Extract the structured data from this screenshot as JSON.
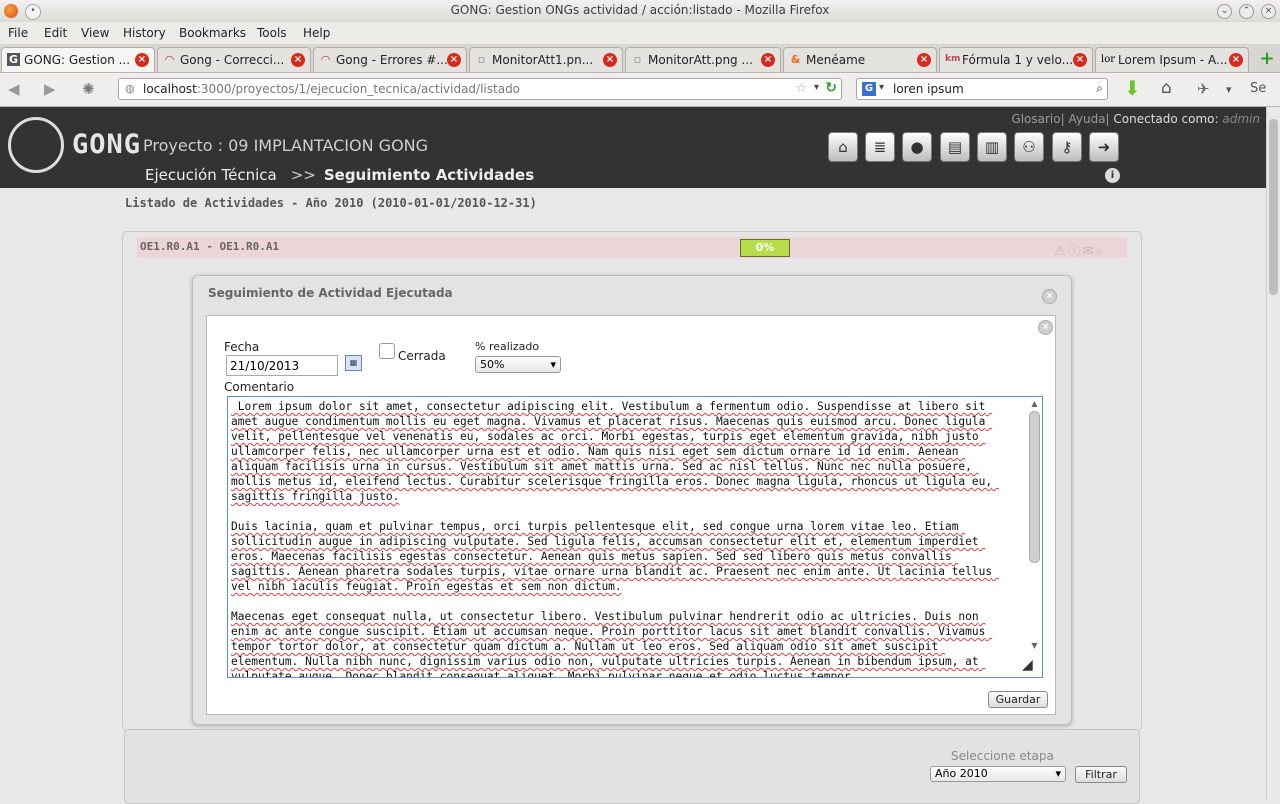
{
  "window": {
    "title": "GONG: Gestion ONGs actividad / acción:listado - Mozilla Firefox"
  },
  "menu": [
    "File",
    "Edit",
    "View",
    "History",
    "Bookmarks",
    "Tools",
    "Help"
  ],
  "tabs": [
    {
      "label": "GONG: Gestion ...",
      "icon": "G"
    },
    {
      "label": "Gong - Correcci...",
      "icon": "◠"
    },
    {
      "label": "Gong - Errores #...",
      "icon": "◠"
    },
    {
      "label": "MonitorAtt1.pn...",
      "icon": "▫"
    },
    {
      "label": "MonitorAtt.png ...",
      "icon": "▫"
    },
    {
      "label": "Menéame",
      "icon": "&"
    },
    {
      "label": "Fórmula 1 y velo...",
      "icon": "km"
    },
    {
      "label": "Lorem Ipsum - A...",
      "icon": "lor"
    }
  ],
  "nav": {
    "url_host": "localhost",
    "url_path": ":3000/proyectos/1/ejecucion_tecnica/actividad/listado",
    "search_query": "loren ipsum"
  },
  "app": {
    "logo": "GONG",
    "project": "Proyecto : 09 IMPLANTACION GONG",
    "links": {
      "glosario": "Glosario",
      "ayuda": "Ayuda",
      "conectado": "Conectado como:",
      "user": "admin"
    },
    "breadcrumb": {
      "section": "Ejecución Técnica",
      "separator": ">>",
      "current": "Seguimiento Actividades"
    },
    "header_icons": [
      "home-icon",
      "database-icon",
      "user-icon",
      "book-icon",
      "chart-icon",
      "users-icon",
      "key-icon",
      "logout-icon"
    ]
  },
  "list": {
    "title": "Listado de Actividades - Año 2010 (2010-01-01/2010-12-31)",
    "activity_code": "OE1.R0.A1 - OE1.R0.A1",
    "progress": "0%"
  },
  "modal": {
    "title": "Seguimiento de Actividad Ejecutada",
    "fecha_label": "Fecha",
    "fecha_value": "21/10/2013",
    "cerrada_label": "Cerrada",
    "realizado_label": "% realizado",
    "realizado_value": "50%",
    "comentario_label": "Comentario",
    "comentario": " Lorem ipsum dolor sit amet, consectetur adipiscing elit. Vestibulum a fermentum odio. Suspendisse at libero sit amet augue condimentum mollis eu eget magna. Vivamus et placerat risus. Maecenas quis euismod arcu. Donec ligula velit, pellentesque vel venenatis eu, sodales ac orci. Morbi egestas, turpis eget elementum gravida, nibh justo ullamcorper felis, nec ullamcorper urna est et odio. Nam quis nisi eget sem dictum ornare id id enim. Aenean aliquam facilisis urna in cursus. Vestibulum sit amet mattis urna. Sed ac nisl tellus. Nunc nec nulla posuere, mollis metus id, eleifend lectus. Curabitur scelerisque fringilla eros. Donec magna ligula, rhoncus ut ligula eu, sagittis fringilla justo.\n\nDuis lacinia, quam et pulvinar tempus, orci turpis pellentesque elit, sed congue urna lorem vitae leo. Etiam sollicitudin augue in adipiscing vulputate. Sed ligula felis, accumsan consectetur elit et, elementum imperdiet eros. Maecenas facilisis egestas consectetur. Aenean quis metus sapien. Sed sed libero quis metus convallis sagittis. Aenean pharetra sodales turpis, vitae ornare urna blandit ac. Praesent nec enim ante. Ut lacinia tellus vel nibh iaculis feugiat. Proin egestas et sem non dictum.\n\nMaecenas eget consequat nulla, ut consectetur libero. Vestibulum pulvinar hendrerit odio ac ultricies. Duis non enim ac ante congue suscipit. Etiam ut accumsan neque. Proin porttitor lacus sit amet blandit convallis. Vivamus tempor tortor dolor, at consectetur quam dictum a. Nullam ut leo eros. Sed aliquam odio sit amet suscipit elementum. Nulla nibh nunc, dignissim varius odio non, vulputate ultricies turpis. Aenean in bibendum ipsum, at vulputate augue. Donec blandit consequat aliquet. Morbi pulvinar neque et odio luctus tempor.",
    "save_label": "Guardar"
  },
  "filter": {
    "label": "Seleccione etapa",
    "selected": "Año 2010",
    "button": "Filtrar"
  }
}
